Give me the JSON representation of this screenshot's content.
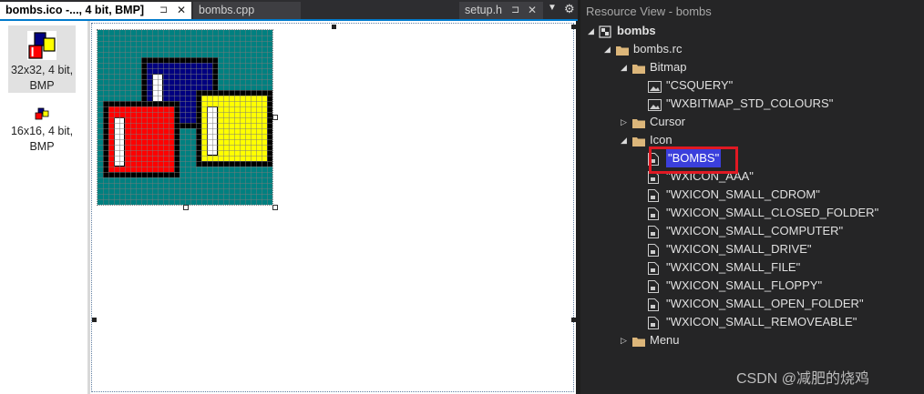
{
  "tabs": {
    "active": {
      "label": "bombs.ico -..., 4 bit, BMP]",
      "pin": "⊐",
      "close": "✕"
    },
    "second": {
      "label": "bombs.cpp"
    },
    "third": {
      "label": "setup.h",
      "pin": "⊐",
      "close": "✕"
    },
    "dropdown": "▼",
    "gear": "⚙"
  },
  "formats": [
    {
      "label": "32x32, 4 bit, BMP",
      "icon": "bombs-icon-large"
    },
    {
      "label": "16x16, 4 bit, BMP",
      "icon": "bombs-icon-small"
    }
  ],
  "resource_view": {
    "title": "Resource View - bombs",
    "tree": [
      {
        "label": "bombs",
        "icon": "project-icon",
        "arrow": "◢"
      },
      {
        "label": "bombs.rc",
        "icon": "folder-icon",
        "arrow": "◢"
      },
      {
        "label": "Bitmap",
        "icon": "folder-icon",
        "arrow": "◢"
      },
      {
        "label": "\"CSQUERY\"",
        "icon": "bitmap-icon",
        "arrow": ""
      },
      {
        "label": "\"WXBITMAP_STD_COLOURS\"",
        "icon": "bitmap-icon",
        "arrow": ""
      },
      {
        "label": "Cursor",
        "icon": "folder-icon",
        "arrow": "▷"
      },
      {
        "label": "Icon",
        "icon": "folder-icon",
        "arrow": "◢"
      },
      {
        "label": "\"BOMBS\"",
        "icon": "icon-file-icon",
        "arrow": ""
      },
      {
        "label": "\"WXICON_AAA\"",
        "icon": "icon-file-icon",
        "arrow": ""
      },
      {
        "label": "\"WXICON_SMALL_CDROM\"",
        "icon": "icon-file-icon",
        "arrow": ""
      },
      {
        "label": "\"WXICON_SMALL_CLOSED_FOLDER\"",
        "icon": "icon-file-icon",
        "arrow": ""
      },
      {
        "label": "\"WXICON_SMALL_COMPUTER\"",
        "icon": "icon-file-icon",
        "arrow": ""
      },
      {
        "label": "\"WXICON_SMALL_DRIVE\"",
        "icon": "icon-file-icon",
        "arrow": ""
      },
      {
        "label": "\"WXICON_SMALL_FILE\"",
        "icon": "icon-file-icon",
        "arrow": ""
      },
      {
        "label": "\"WXICON_SMALL_FLOPPY\"",
        "icon": "icon-file-icon",
        "arrow": ""
      },
      {
        "label": "\"WXICON_SMALL_OPEN_FOLDER\"",
        "icon": "icon-file-icon",
        "arrow": ""
      },
      {
        "label": "\"WXICON_SMALL_REMOVEABLE\"",
        "icon": "icon-file-icon",
        "arrow": ""
      },
      {
        "label": "Menu",
        "icon": "folder-icon",
        "arrow": "▷"
      }
    ],
    "selected": "\"BOMBS\""
  },
  "watermark": "CSDN @减肥的烧鸡",
  "colors": {
    "accent": "#007acc",
    "teal": "#008080",
    "navy": "#000080",
    "red": "#ff0000",
    "yellow": "#ffff00",
    "black": "#000000",
    "white": "#ffffff",
    "selection": "#3b3fdc",
    "highlight_box": "#e01923"
  }
}
